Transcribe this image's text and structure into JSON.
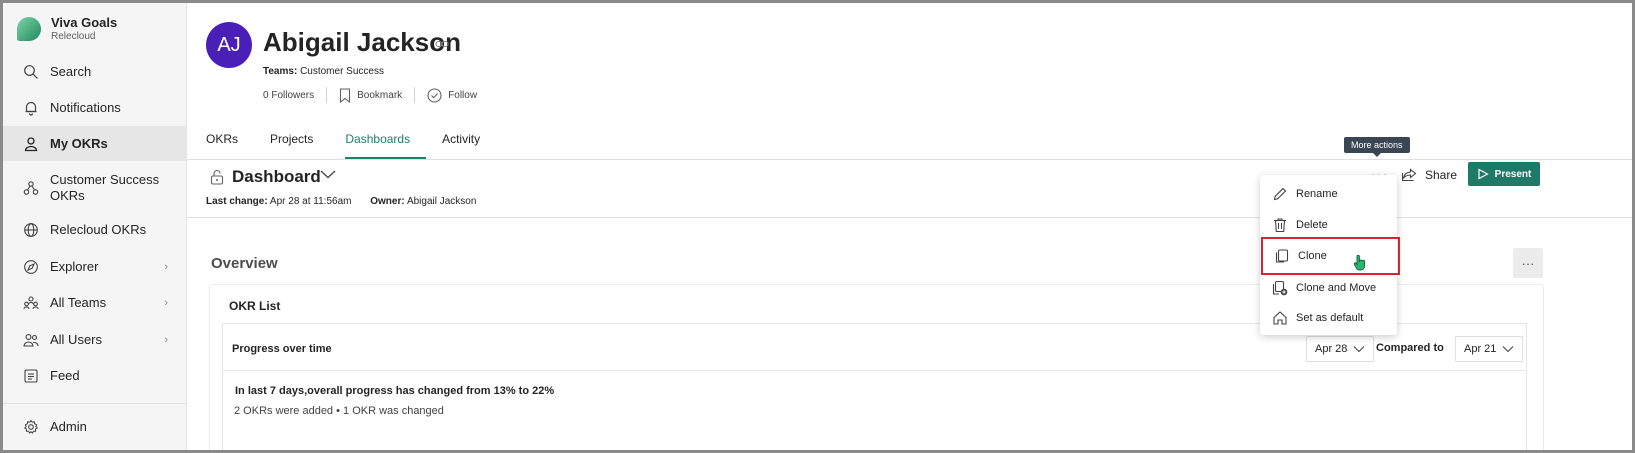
{
  "brand": {
    "name": "Viva Goals",
    "org": "Relecloud"
  },
  "sidebar": {
    "items": [
      {
        "label": "Search"
      },
      {
        "label": "Notifications"
      },
      {
        "label": "My OKRs"
      },
      {
        "label_line1": "Customer Success",
        "label_line2": "OKRs"
      },
      {
        "label": "Relecloud OKRs"
      },
      {
        "label": "Explorer"
      },
      {
        "label": "All Teams"
      },
      {
        "label": "All Users"
      },
      {
        "label": "Feed"
      },
      {
        "label": "Admin"
      }
    ]
  },
  "profile": {
    "initials": "AJ",
    "name": "Abigail Jackson",
    "teams_label": "Teams:",
    "teams_value": "Customer Success",
    "followers": "0 Followers",
    "bookmark": "Bookmark",
    "follow": "Follow"
  },
  "tabs": [
    {
      "label": "OKRs"
    },
    {
      "label": "Projects"
    },
    {
      "label": "Dashboards"
    },
    {
      "label": "Activity"
    }
  ],
  "dashboard": {
    "title": "Dashboard",
    "last_change_label": "Last change:",
    "last_change_value": "Apr 28 at 11:56am",
    "owner_label": "Owner:",
    "owner_value": "Abigail Jackson",
    "more_actions_tooltip": "More actions",
    "more_dots": "···",
    "share_label": "Share",
    "present_label": "Present"
  },
  "menu": {
    "items": [
      {
        "label": "Rename"
      },
      {
        "label": "Delete"
      },
      {
        "label": "Clone"
      },
      {
        "label": "Clone and Move"
      },
      {
        "label": "Set as default"
      }
    ]
  },
  "overview": {
    "title": "Overview",
    "dots": "···",
    "card_title": "OKR List",
    "progress_title": "Progress over time",
    "date_from": "Apr 28",
    "compared_to_label": "Compared to",
    "date_to": "Apr 21",
    "progress_text": "In last 7 days,overall progress has changed from 13% to 22%",
    "progress_sub": "2 OKRs were added • 1 OKR was changed"
  },
  "colors": {
    "accent": "#1a7f6b",
    "present_bg": "#1e7a66",
    "avatar_bg": "#4a1fb8",
    "highlight_border": "#d9232e"
  }
}
